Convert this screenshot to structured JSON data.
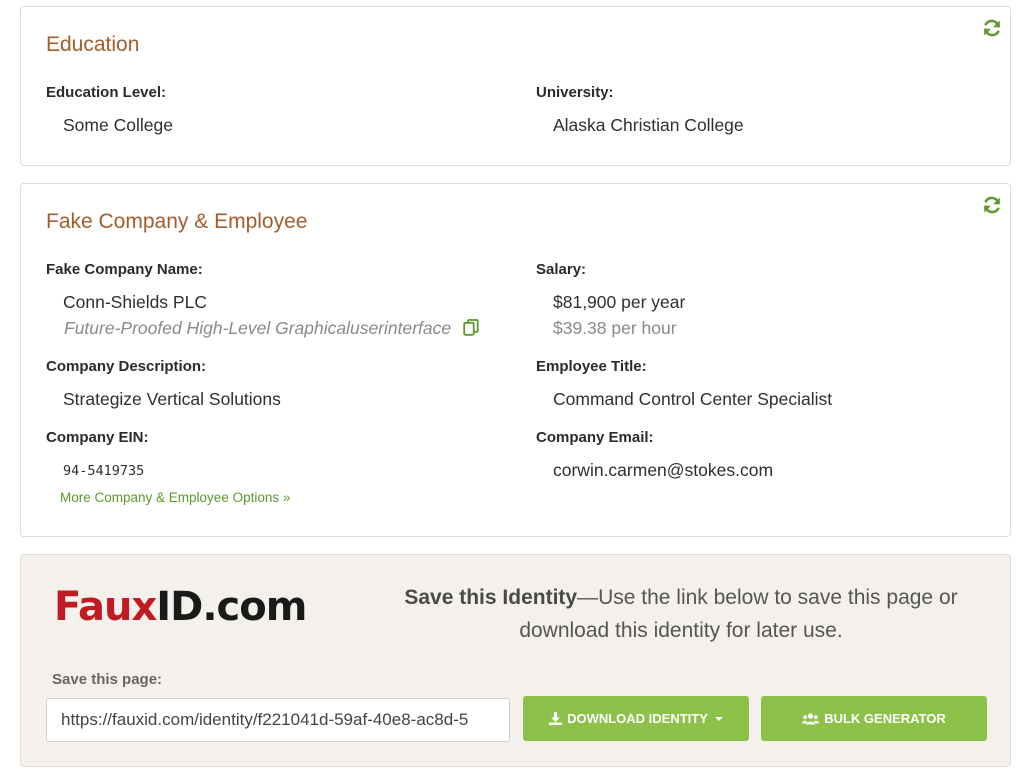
{
  "education": {
    "title": "Education",
    "refresh_icon": "refresh-icon",
    "level_label": "Education Level:",
    "level_value": "Some College",
    "university_label": "University:",
    "university_value": "Alaska Christian College"
  },
  "company": {
    "title": "Fake Company & Employee",
    "refresh_icon": "refresh-icon",
    "name_label": "Fake Company Name:",
    "name_value": "Conn-Shields PLC",
    "slogan": "Future-Proofed High-Level Graphicaluserinterface",
    "copy_icon": "copy-icon",
    "salary_label": "Salary:",
    "salary_year": "$81,900 per year",
    "salary_hour": "$39.38 per hour",
    "description_label": "Company Description:",
    "description_value": "Strategize Vertical Solutions",
    "title_label": "Employee Title:",
    "title_value": "Command Control Center Specialist",
    "ein_label": "Company EIN:",
    "ein_value": "94-5419735",
    "email_label": "Company Email:",
    "email_value": "corwin.carmen@stokes.com",
    "more_link": "More Company & Employee Options »"
  },
  "save": {
    "logo_faux": "Faux",
    "logo_idcom": "ID.com",
    "heading_bold": "Save this Identity",
    "heading_rest": "—Use the link below to save this page or download this identity for later use.",
    "save_label": "Save this page:",
    "url_value": "https://fauxid.com/identity/f221041d-59af-40e8-ac8d-5",
    "download_label": "DOWNLOAD IDENTITY",
    "bulk_label": "BULK GENERATOR",
    "download_icon": "download-icon",
    "bulk_icon": "users-icon"
  },
  "colors": {
    "heading": "#a25e2c",
    "accent_green": "#8cc24a",
    "link_green": "#5b9a2c",
    "logo_red": "#c01b22"
  }
}
